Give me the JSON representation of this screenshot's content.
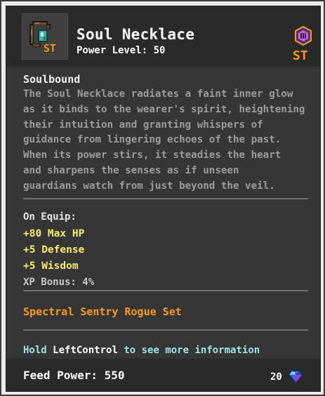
{
  "item": {
    "name": "Soul Necklace",
    "power_level": "Power Level: 50",
    "badge": "ST",
    "tier_badge": "ST",
    "icon": "soul-necklace-icon",
    "tier_icon": "tier-emblem-icon"
  },
  "soulbound": "Soulbound",
  "lore_lines": [
    "The Soul Necklace radiates a faint inner glow",
    "as it binds to the wearer's spirit, heightening",
    "their intuition and granting whispers of",
    "guidance from lingering echoes of the past.",
    "When its power stirs, it steadies the heart",
    "and sharpens the senses as if unseen",
    "guardians watch from just beyond the veil."
  ],
  "on_equip": {
    "label": "On Equip:",
    "stats": [
      "+80 Max HP",
      "+5 Defense",
      "+5 Wisdom"
    ],
    "xp_bonus": "XP Bonus: 4%"
  },
  "set_name": "Spectral Sentry Rogue Set",
  "hint": {
    "prefix": "Hold",
    "key": "LeftControl",
    "suffix": "to see more information"
  },
  "footer": {
    "feed_power": "Feed Power: 550",
    "cost": "20",
    "cost_icon": "blue-gem-icon"
  },
  "colors": {
    "background": "#363636",
    "header": "#2a2a2a",
    "stat": "#f5ee6a",
    "set": "#ff9a1c",
    "hint": "#9ee5e5",
    "lore": "#9c9c9c"
  }
}
